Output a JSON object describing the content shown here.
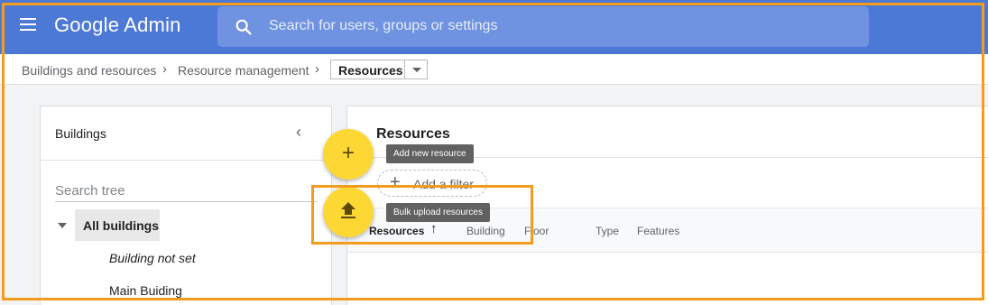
{
  "header": {
    "brand": "Google Admin",
    "search_placeholder": "Search for users, groups or settings"
  },
  "breadcrumb": {
    "items": [
      "Buildings and resources",
      "Resource management"
    ],
    "separator": "›",
    "current": "Resources"
  },
  "buildings_panel": {
    "title": "Buildings",
    "search_placeholder": "Search tree",
    "root_label": "All buildings",
    "items": [
      "Building not set",
      "Main Buiding"
    ]
  },
  "resources_panel": {
    "title": "Resources",
    "add_filter_label": "Add a filter",
    "columns": [
      "Resources",
      "Building",
      "Floor",
      "Type",
      "Features"
    ],
    "sort_icon": "arrow-upward-icon"
  },
  "fabs": {
    "add_icon": "plus",
    "add_tooltip": "Add new resource",
    "upload_icon": "upload-icon",
    "upload_tooltip": "Bulk upload resources"
  },
  "colors": {
    "header_bg": "#4d79d6",
    "fab_yellow": "#fdd835",
    "highlight_orange": "#f39c1e",
    "tooltip_bg": "#616161"
  }
}
